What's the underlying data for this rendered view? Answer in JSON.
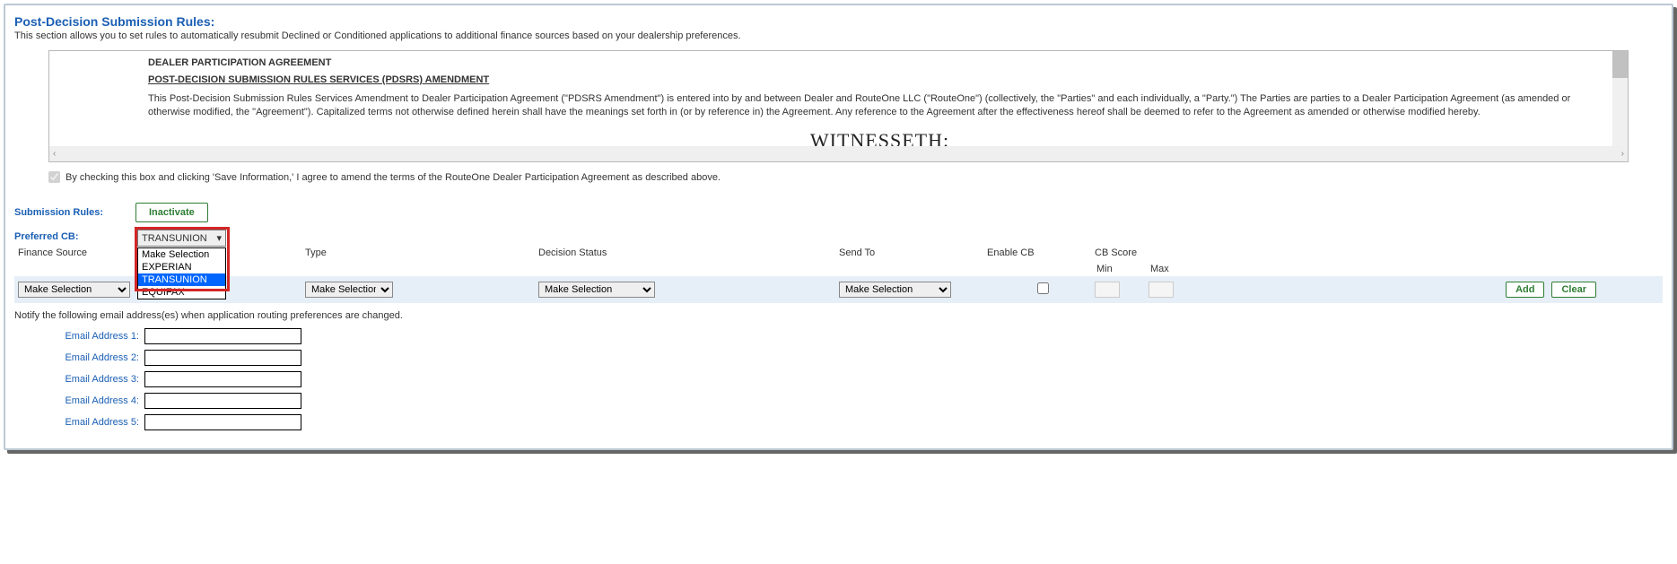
{
  "section": {
    "title": "Post-Decision Submission Rules:",
    "description": "This section allows you to set rules to automatically resubmit Declined or Conditioned applications to additional finance sources based on your dealership preferences."
  },
  "agreement": {
    "dpa_title": "DEALER PARTICIPATION AGREEMENT",
    "pdsrs_title": "POST-DECISION SUBMISSION RULES SERVICES (PDSRS) AMENDMENT",
    "body": "This Post-Decision Submission Rules Services Amendment to Dealer Participation Agreement (\"PDSRS Amendment\") is entered into by and between Dealer and RouteOne LLC (\"RouteOne\") (collectively, the \"Parties\" and each individually, a \"Party.\") The Parties are parties to a Dealer Participation Agreement (as amended or otherwise modified, the \"Agreement\"). Capitalized terms not otherwise defined herein shall have the meanings set forth in (or by reference in) the Agreement. Any reference to the Agreement after the effectiveness hereof shall be deemed to refer to the Agreement as amended or otherwise modified hereby.",
    "witnesseth": "WITNESSETH:"
  },
  "consent": {
    "text": "By checking this box and clicking 'Save Information,' I agree to amend the terms of the RouteOne Dealer Participation Agreement as described above.",
    "checked": true
  },
  "submission_rules": {
    "label": "Submission Rules:",
    "inactivate_btn": "Inactivate"
  },
  "preferred_cb": {
    "label": "Preferred CB:",
    "selected": "TRANSUNION",
    "options": [
      "Make Selection",
      "EXPERIAN",
      "TRANSUNION",
      "EQUIFAX"
    ]
  },
  "columns": {
    "finance_source": "Finance Source",
    "type": "Type",
    "decision_status": "Decision Status",
    "send_to": "Send To",
    "enable_cb": "Enable CB",
    "cb_score": "CB Score",
    "min": "Min",
    "max": "Max"
  },
  "row": {
    "finance_source_value": "Make Selection",
    "type_value": "Make Selection",
    "decision_status_value": "Make Selection",
    "send_to_value": "Make Selection",
    "enable_cb_checked": false,
    "min": "",
    "max": "",
    "add_btn": "Add",
    "clear_btn": "Clear"
  },
  "notify": {
    "text": "Notify the following email address(es) when application routing preferences are changed."
  },
  "emails": {
    "address1_label": "Email Address 1:",
    "address2_label": "Email Address 2:",
    "address3_label": "Email Address 3:",
    "address4_label": "Email Address 4:",
    "address5_label": "Email Address 5:",
    "address1": "",
    "address2": "",
    "address3": "",
    "address4": "",
    "address5": ""
  }
}
